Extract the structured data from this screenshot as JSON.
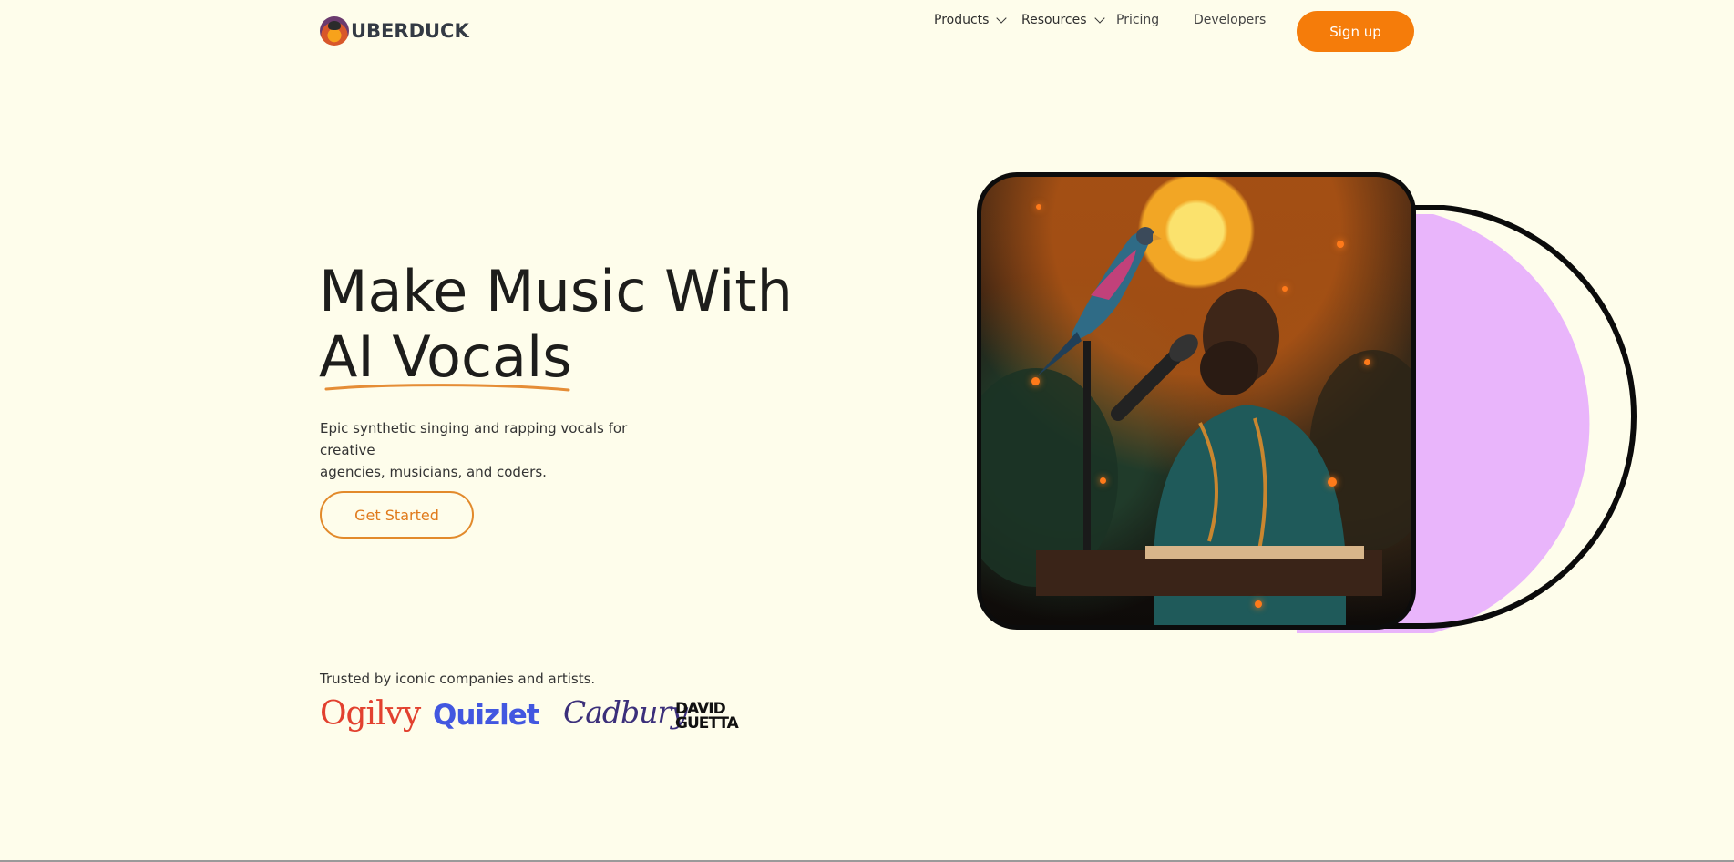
{
  "brand": {
    "name": "UBERDUCK"
  },
  "nav": {
    "items": [
      {
        "label": "Products",
        "dropdown": true
      },
      {
        "label": "Resources",
        "dropdown": true
      },
      {
        "label": "Pricing",
        "dropdown": false
      },
      {
        "label": "Developers",
        "dropdown": false
      }
    ],
    "signup_label": "Sign up"
  },
  "hero": {
    "title_line1": "Make Music With",
    "title_line2": "AI Vocals",
    "subtitle_line1": "Epic synthetic singing and rapping vocals for creative",
    "subtitle_line2": "agencies, musicians, and coders.",
    "cta_label": "Get Started"
  },
  "trusted": {
    "label": "Trusted by iconic companies and artists.",
    "logos": [
      "Ogilvy",
      "Quizlet",
      "Cadbury",
      "DAVID",
      "GUETTA"
    ]
  },
  "colors": {
    "accent": "#f57c0a",
    "background": "#fefdeb",
    "purple_shape": "#e9b5fb"
  },
  "icons": {
    "logo": "duck-logo-icon",
    "dropdown": "chevron-down-icon"
  }
}
